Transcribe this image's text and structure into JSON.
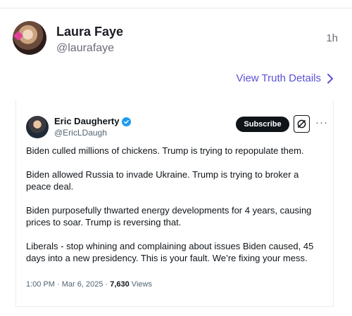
{
  "post": {
    "author_name": "Laura Faye",
    "author_handle": "@laurafaye",
    "time": "1h",
    "details_link": "View Truth Details"
  },
  "embed": {
    "name": "Eric Daugherty",
    "handle": "@EricLDaugh",
    "subscribe_label": "Subscribe",
    "more_label": "···",
    "paragraphs": [
      "Biden culled millions of chickens. Trump is trying to repopulate them.",
      "Biden allowed Russia to invade Ukraine. Trump is trying to broker a peace deal.",
      "Biden purposefully thwarted energy developments for 4 years, causing prices to soar. Trump is reversing that.",
      "Liberals - stop whining and complaining about issues Biden caused, 45 days into a new presidency. This is your fault. We’re fixing your mess."
    ],
    "datetime": "1:00 PM · Mar 6, 2025 · ",
    "views_count": "7,630",
    "views_label": " Views"
  },
  "icons": {
    "details_chevron": "chevron-right-icon",
    "verified": "verified-badge-icon",
    "grok": "grok-icon"
  },
  "colors": {
    "link": "#5b52d6",
    "verified": "#1d9bf0",
    "subscribe_bg": "#0f1419"
  }
}
